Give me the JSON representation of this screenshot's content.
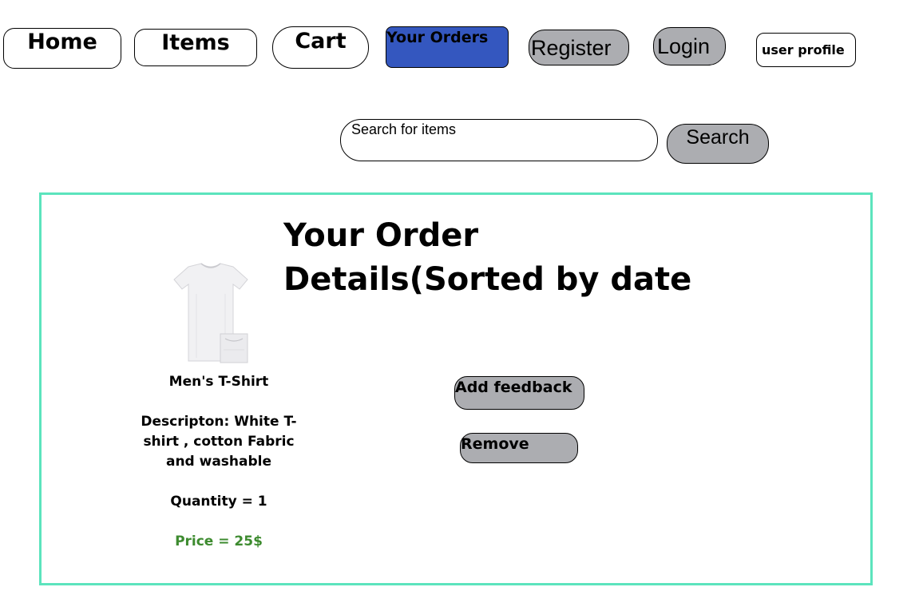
{
  "nav": {
    "home": "Home",
    "items": "Items",
    "cart": "Cart",
    "orders": "Your Orders",
    "register": "Register",
    "login": "Login",
    "user_profile": "user profile"
  },
  "search": {
    "placeholder": "Search for items",
    "button": "Search"
  },
  "order": {
    "title": "Your Order Details(Sorted by date",
    "product_name": "Men's  T-Shirt",
    "description": "Descripton: White T-shirt , cotton Fabric and washable",
    "quantity": "Quantity = 1",
    "price": "Price = 25$",
    "add_feedback": "Add feedback",
    "remove": "Remove"
  },
  "colors": {
    "active_tab": "#3457bf",
    "button_gray": "#acadb1",
    "panel_border": "#5ce4bd",
    "price": "#3d8b2f"
  }
}
